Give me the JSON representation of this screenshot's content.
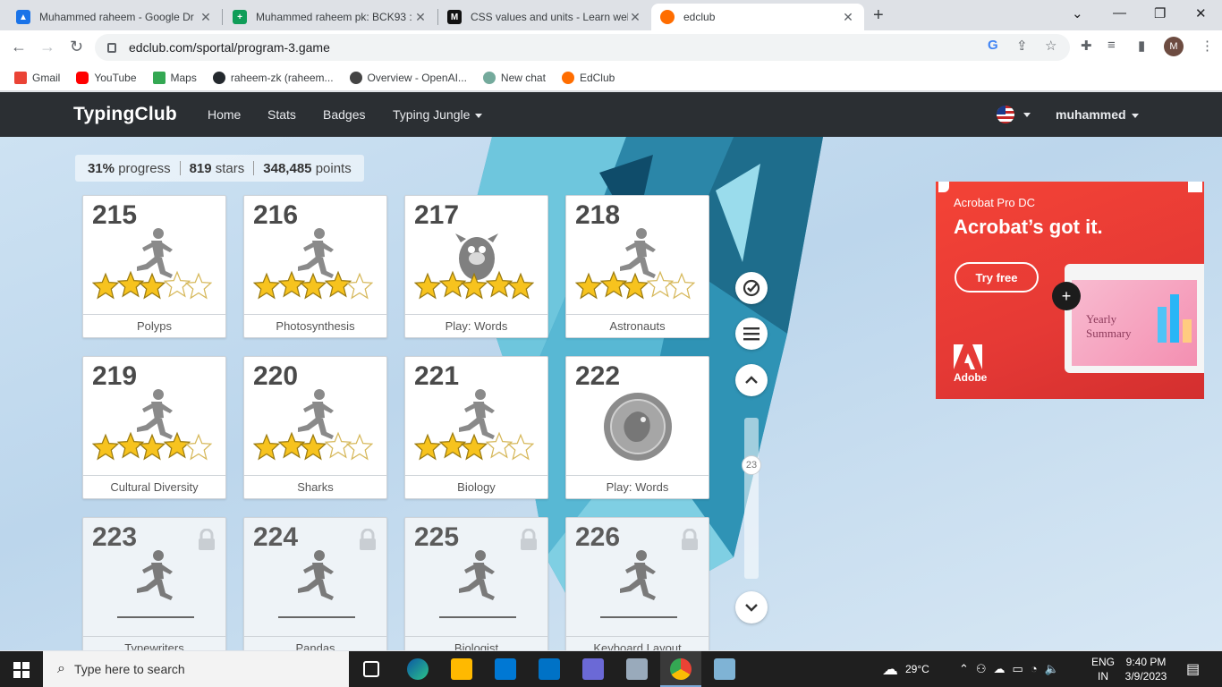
{
  "browser": {
    "tabs": [
      {
        "title": "Muhammed raheem - Google Dr",
        "icon": "google-drive-icon",
        "color": "#1a73e8"
      },
      {
        "title": "Muhammed raheem pk: BCK93 :",
        "icon": "google-sheets-icon",
        "color": "#0f9d58"
      },
      {
        "title": "CSS values and units - Learn web",
        "icon": "mdn-icon",
        "color": "#111111"
      },
      {
        "title": "edclub",
        "icon": "edclub-icon",
        "color": "#ff6d00"
      }
    ],
    "url": "edclub.com/sportal/program-3.game",
    "profile_initial": "M",
    "bookmarks": [
      {
        "label": "Gmail",
        "icon": "gmail-icon",
        "color": "#ea4335"
      },
      {
        "label": "YouTube",
        "icon": "youtube-icon",
        "color": "#ff0000"
      },
      {
        "label": "Maps",
        "icon": "maps-icon",
        "color": "#34a853"
      },
      {
        "label": "raheem-zk (raheem...",
        "icon": "github-icon",
        "color": "#24292e"
      },
      {
        "label": "Overview - OpenAI...",
        "icon": "openai-icon",
        "color": "#444444"
      },
      {
        "label": "New chat",
        "icon": "chatgpt-icon",
        "color": "#74aa9c"
      },
      {
        "label": "EdClub",
        "icon": "edclub-icon",
        "color": "#ff6d00"
      }
    ]
  },
  "site": {
    "brand": "TypingClub",
    "nav": [
      "Home",
      "Stats",
      "Badges",
      "Typing Jungle"
    ],
    "user": "muhammed",
    "language_icon": "us-flag-icon"
  },
  "stats": {
    "progress_value": "31%",
    "progress_label": "progress",
    "stars_value": "819",
    "stars_label": "stars",
    "points_value": "348,485",
    "points_label": "points"
  },
  "lessons": [
    {
      "num": "215",
      "name": "Polyps",
      "type": "lesson",
      "stars": 3,
      "locked": false
    },
    {
      "num": "216",
      "name": "Photosynthesis",
      "type": "lesson",
      "stars": 4,
      "locked": false
    },
    {
      "num": "217",
      "name": "Play: Words",
      "type": "game",
      "stars": 5,
      "locked": false
    },
    {
      "num": "218",
      "name": "Astronauts",
      "type": "lesson",
      "stars": 3,
      "locked": false
    },
    {
      "num": "219",
      "name": "Cultural Diversity",
      "type": "lesson",
      "stars": 4,
      "locked": false
    },
    {
      "num": "220",
      "name": "Sharks",
      "type": "lesson",
      "stars": 3,
      "locked": false
    },
    {
      "num": "221",
      "name": "Biology",
      "type": "lesson",
      "stars": 3,
      "locked": false
    },
    {
      "num": "222",
      "name": "Play: Words",
      "type": "game-badge",
      "stars": 0,
      "locked": false
    },
    {
      "num": "223",
      "name": "Typewriters",
      "type": "lesson",
      "stars": 0,
      "locked": true
    },
    {
      "num": "224",
      "name": "Pandas",
      "type": "lesson",
      "stars": 0,
      "locked": true
    },
    {
      "num": "225",
      "name": "Biologist",
      "type": "lesson",
      "stars": 0,
      "locked": true
    },
    {
      "num": "226",
      "name": "Keyboard Layout",
      "type": "lesson",
      "stars": 0,
      "locked": true
    }
  ],
  "side_controls": {
    "page_indicator": "23"
  },
  "ad": {
    "product": "Acrobat Pro DC",
    "headline": "Acrobat’s got it.",
    "cta": "Try free",
    "screen_text": "Yearly Summary",
    "brand": "Adobe",
    "accent": "#f44336"
  },
  "taskbar": {
    "search_placeholder": "Type here to search",
    "weather": "29°C",
    "lang": "ENG",
    "region": "IN",
    "time": "9:40 PM",
    "date": "3/9/2023"
  }
}
